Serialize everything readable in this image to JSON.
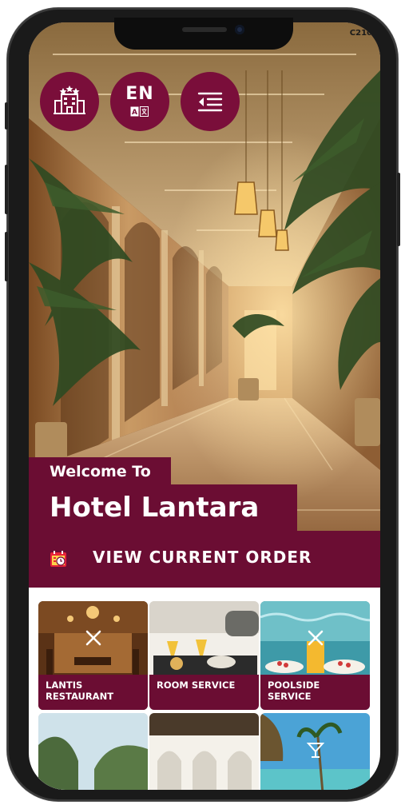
{
  "status_bar": {
    "text": "C210"
  },
  "header_buttons": [
    {
      "name": "hotel",
      "icon": "hotel-building-icon"
    },
    {
      "name": "language",
      "code": "EN",
      "icon": "translate-icon"
    },
    {
      "name": "menu",
      "icon": "menu-indent-icon"
    }
  ],
  "hero": {
    "welcome": "Welcome To",
    "hotel_name": "Hotel Lantara"
  },
  "order_bar": {
    "label": "VIEW CURRENT ORDER",
    "icon": "order-calendar-icon"
  },
  "tiles": [
    {
      "label": "LANTIS RESTAURANT",
      "icon": "cutlery-icon"
    },
    {
      "label": "ROOM SERVICE",
      "icon": ""
    },
    {
      "label": "POOLSIDE SERVICE",
      "icon": "cutlery-icon"
    },
    {
      "label": "",
      "icon": ""
    },
    {
      "label": "",
      "icon": ""
    },
    {
      "label": "",
      "icon": "cocktail-icon"
    }
  ],
  "colors": {
    "brand": "#6b0d33",
    "button": "#7a0e3a",
    "frame": "#1a1a1a"
  }
}
